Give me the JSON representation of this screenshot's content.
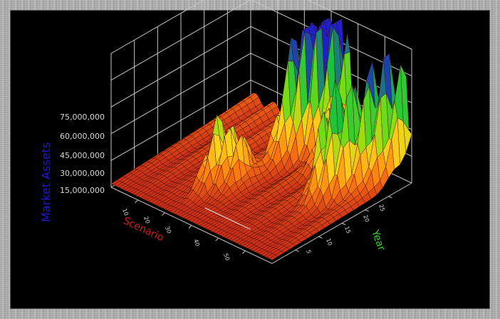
{
  "chart_data": {
    "type": "surface",
    "title": "",
    "ylabel": "Market Assets",
    "xlabel": "Scenario",
    "zlabel": "Year",
    "value_ticks": [
      "15,000,000",
      "30,000,000",
      "45,000,000",
      "60,000,000",
      "75,000,000"
    ],
    "scenario_ticks": [
      "10",
      "20",
      "30",
      "40",
      "50"
    ],
    "year_ticks": [
      "5",
      "10",
      "15",
      "20",
      "25"
    ],
    "ylim": [
      0,
      95000000
    ],
    "colorscale": [
      "#c0201a",
      "#ff7a10",
      "#ffd21a",
      "#7ee010",
      "#18c040",
      "#2020c8"
    ],
    "peaks": [
      {
        "scenario": 22,
        "year": 10,
        "value": 45000000
      },
      {
        "scenario": 26,
        "year": 12,
        "value": 40000000
      },
      {
        "scenario": 28,
        "year": 22,
        "value": 62000000
      },
      {
        "scenario": 30,
        "year": 25,
        "value": 60000000
      },
      {
        "scenario": 31,
        "year": 27,
        "value": 68000000
      },
      {
        "scenario": 33,
        "year": 28,
        "value": 92000000
      },
      {
        "scenario": 36,
        "year": 30,
        "value": 70000000
      },
      {
        "scenario": 40,
        "year": 24,
        "value": 48000000
      },
      {
        "scenario": 49,
        "year": 18,
        "value": 58000000
      },
      {
        "scenario": 52,
        "year": 20,
        "value": 62000000
      },
      {
        "scenario": 54,
        "year": 24,
        "value": 64000000
      },
      {
        "scenario": 56,
        "year": 27,
        "value": 60000000
      },
      {
        "scenario": 58,
        "year": 30,
        "value": 55000000
      }
    ]
  }
}
